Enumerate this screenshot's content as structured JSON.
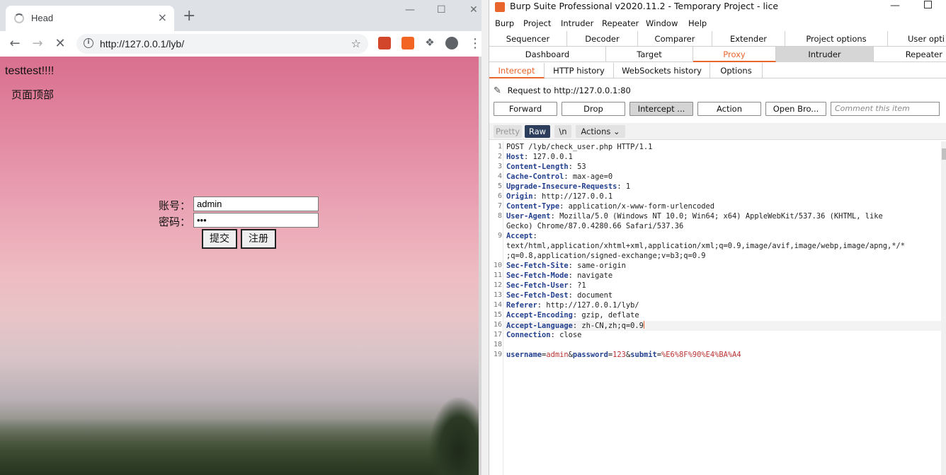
{
  "browser": {
    "tab_title": "Head",
    "tab_close": "×",
    "new_tab": "+",
    "url": "http://127.0.0.1/lyb/",
    "window_controls": {
      "minimize": "—",
      "maximize": "☐",
      "close": "✕"
    }
  },
  "page": {
    "site_title": "testtest!!!!",
    "page_top": "页面顶部",
    "account_label": "账号：",
    "account_value": "admin",
    "password_label": "密码：",
    "password_value": "123",
    "submit_label": "提交",
    "register_label": "注册"
  },
  "burp": {
    "title": "Burp Suite Professional v2020.11.2 - Temporary Project - lice",
    "menu": [
      "Burp",
      "Project",
      "Intruder",
      "Repeater",
      "Window",
      "Help"
    ],
    "tabs_row1": [
      "Sequencer",
      "Decoder",
      "Comparer",
      "Extender",
      "Project options",
      "User opti"
    ],
    "tabs_row2": [
      "Dashboard",
      "Target",
      "Proxy",
      "Intruder",
      "Repeater"
    ],
    "subtabs": [
      "Intercept",
      "HTTP history",
      "WebSockets history",
      "Options"
    ],
    "request_to": "Request to http://127.0.0.1:80",
    "buttons": {
      "forward": "Forward",
      "drop": "Drop",
      "intercept": "Intercept ...",
      "action": "Action",
      "open_browser": "Open Bro..."
    },
    "comment_placeholder": "Comment this item",
    "editor_bar": {
      "pretty": "Pretty",
      "raw": "Raw",
      "newline": "\\n",
      "actions": "Actions"
    },
    "request_lines": [
      {
        "n": "1",
        "text": "POST /lyb/check_user.php HTTP/1.1"
      },
      {
        "n": "2",
        "key": "Host",
        "val": "127.0.0.1"
      },
      {
        "n": "3",
        "key": "Content-Length",
        "val": "53"
      },
      {
        "n": "4",
        "key": "Cache-Control",
        "val": "max-age=0"
      },
      {
        "n": "5",
        "key": "Upgrade-Insecure-Requests",
        "val": "1"
      },
      {
        "n": "6",
        "key": "Origin",
        "val": "http://127.0.0.1"
      },
      {
        "n": "7",
        "key": "Content-Type",
        "val": "application/x-www-form-urlencoded"
      },
      {
        "n": "8",
        "key": "User-Agent",
        "val": "Mozilla/5.0 (Windows NT 10.0; Win64; x64) AppleWebKit/537.36 (KHTML, like"
      },
      {
        "n": "",
        "text": "Gecko) Chrome/87.0.4280.66 Safari/537.36"
      },
      {
        "n": "9",
        "key": "Accept",
        "val": ""
      },
      {
        "n": "",
        "text": "text/html,application/xhtml+xml,application/xml;q=0.9,image/avif,image/webp,image/apng,*/*"
      },
      {
        "n": "",
        "text": ";q=0.8,application/signed-exchange;v=b3;q=0.9"
      },
      {
        "n": "10",
        "key": "Sec-Fetch-Site",
        "val": "same-origin"
      },
      {
        "n": "11",
        "key": "Sec-Fetch-Mode",
        "val": "navigate"
      },
      {
        "n": "12",
        "key": "Sec-Fetch-User",
        "val": "?1"
      },
      {
        "n": "13",
        "key": "Sec-Fetch-Dest",
        "val": "document"
      },
      {
        "n": "14",
        "key": "Referer",
        "val": "http://127.0.0.1/lyb/"
      },
      {
        "n": "15",
        "key": "Accept-Encoding",
        "val": "gzip, deflate"
      },
      {
        "n": "16",
        "key": "Accept-Language",
        "val": "zh-CN,zh;q=0.9"
      },
      {
        "n": "17",
        "key": "Connection",
        "val": "close"
      },
      {
        "n": "18",
        "text": ""
      },
      {
        "n": "19",
        "body": [
          [
            "username",
            "admin"
          ],
          [
            "password",
            "123"
          ],
          [
            "submit",
            "%E6%8F%90%E4%BA%A4"
          ]
        ]
      }
    ]
  },
  "colors": {
    "burp_accent": "#e8662c",
    "header_key": "#23408e",
    "param_value": "#b33333"
  }
}
